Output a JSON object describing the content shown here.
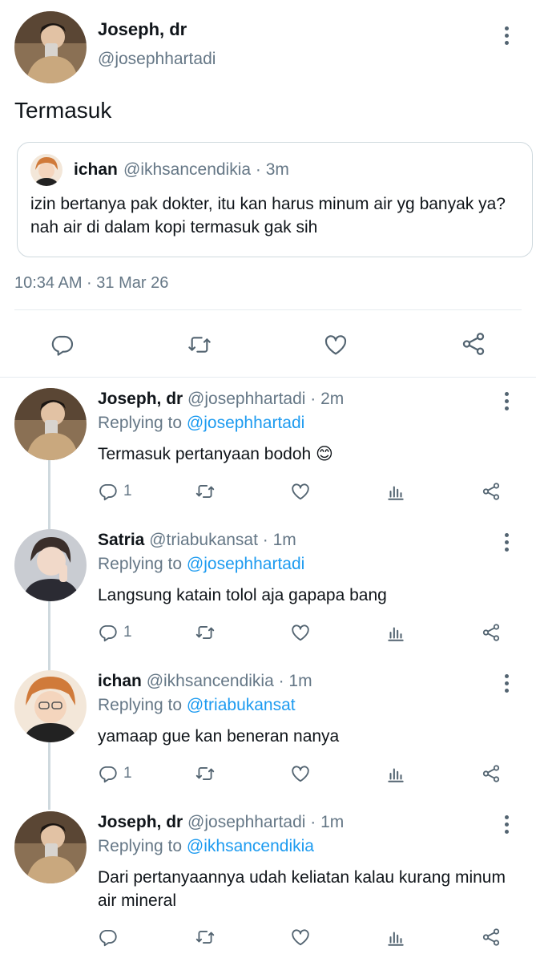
{
  "main_tweet": {
    "author_name": "Joseph, dr",
    "author_handle": "@josephhartadi",
    "text": "Termasuk",
    "timestamp": "10:34 AM · 31 Mar 26",
    "quoted": {
      "author_name": "ichan",
      "meta": "@ikhsancendikia · 3m",
      "text": "izin bertanya pak dokter, itu kan harus minum air yg banyak ya? nah air di dalam kopi termasuk gak sih"
    }
  },
  "replying_to_label": "Replying to",
  "replies": [
    {
      "author_name": "Joseph, dr",
      "meta": "@josephhartadi · 2m",
      "replying_to": "@josephhartadi",
      "text": "Termasuk pertanyaan bodoh 😊",
      "reply_count": "1"
    },
    {
      "author_name": "Satria",
      "meta": "@triabukansat · 1m",
      "replying_to": "@josephhartadi",
      "text": "Langsung katain tolol aja gapapa bang",
      "reply_count": "1"
    },
    {
      "author_name": "ichan",
      "meta": "@ikhsancendikia · 1m",
      "replying_to": "@triabukansat",
      "text": "yamaap gue kan beneran nanya",
      "reply_count": "1"
    },
    {
      "author_name": "Joseph, dr",
      "meta": "@josephhartadi · 1m",
      "replying_to": "@ikhsancendikia",
      "text": "Dari pertanyaannya udah keliatan kalau kurang minum air mineral",
      "reply_count": ""
    }
  ],
  "colors": {
    "link": "#1d9bf0",
    "muted": "#657786",
    "icon": "#536471",
    "divider": "#e6ecf0"
  }
}
